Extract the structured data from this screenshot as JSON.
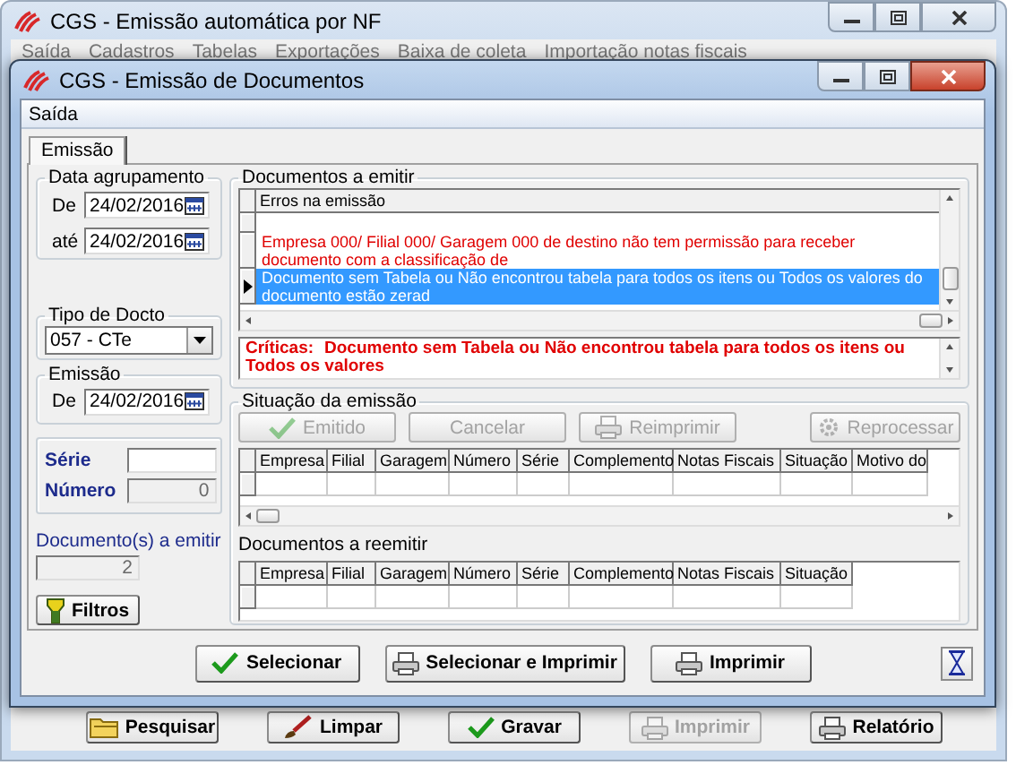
{
  "background_window": {
    "title": "CGS - Emissão automática por NF",
    "menu": [
      "Saída",
      "Cadastros",
      "Tabelas",
      "Exportações",
      "Baixa de coleta",
      "Importação notas fiscais"
    ],
    "buttons": [
      {
        "label": "Pesquisar",
        "kind": "search",
        "disabled": false
      },
      {
        "label": "Limpar",
        "kind": "clear",
        "disabled": false
      },
      {
        "label": "Gravar",
        "kind": "confirm",
        "disabled": false
      },
      {
        "label": "Imprimir",
        "kind": "print",
        "disabled": true
      },
      {
        "label": "Relatório",
        "kind": "print",
        "disabled": false
      }
    ]
  },
  "window": {
    "title": "CGS - Emissão de Documentos",
    "menu": [
      "Saída"
    ],
    "tabs": [
      {
        "label": "Emissão",
        "selected": true
      }
    ],
    "data_agrupamento": {
      "title": "Data agrupamento",
      "fields": [
        {
          "label": "De",
          "value": "24/02/2016"
        },
        {
          "label": "até",
          "value": "24/02/2016"
        }
      ]
    },
    "tipo_docto": {
      "title": "Tipo de Docto",
      "value": "057 - CTe"
    },
    "emissao": {
      "title": "Emissão",
      "fields": [
        {
          "label": "De",
          "value": "24/02/2016"
        }
      ]
    },
    "serie": {
      "label": "Série"
    },
    "numero": {
      "label": "Número",
      "value": "0"
    },
    "documentos_a_emitir": {
      "label": "Documento(s) a emitir",
      "value": "2"
    },
    "filtros_button": {
      "label": "Filtros",
      "kind": "filter"
    },
    "documentos": {
      "title": "Documentos a emitir",
      "column": "Erros na emissão",
      "rows": [
        {
          "selected": false
        },
        {
          "text": "Empresa 000/ Filial 000/ Garagem 000 de destino não tem permissão para receber documento com a classificação de",
          "selected": false
        },
        {
          "text": "Documento sem Tabela ou Não encontrou tabela para todos os itens ou Todos os valores do documento estão zerad",
          "selected": true
        }
      ]
    },
    "criticas": {
      "label": "Críticas:",
      "text": "Documento sem Tabela ou Não encontrou tabela para todos os itens ou Todos os valores"
    },
    "situacao": {
      "title": "Situação da emissão",
      "buttons": [
        {
          "label": "Emitido",
          "kind": "confirm",
          "disabled": true
        },
        {
          "label": "Cancelar",
          "kind": "plain",
          "disabled": true
        },
        {
          "label": "Reimprimir",
          "kind": "print",
          "disabled": true
        },
        {
          "label": "Reprocessar",
          "kind": "reprocess",
          "disabled": true
        }
      ],
      "columns": [
        "Empresa",
        "Filial",
        "Garagem",
        "Número",
        "Série",
        "Complemento",
        "Notas Fiscais",
        "Situação",
        "Motivo do"
      ]
    },
    "reemitir": {
      "title": "Documentos a reemitir",
      "columns": [
        "Empresa",
        "Filial",
        "Garagem",
        "Número",
        "Série",
        "Complemento",
        "Notas Fiscais",
        "Situação"
      ]
    },
    "buttons": [
      {
        "label": "Selecionar",
        "kind": "confirm"
      },
      {
        "label": "Selecionar e Imprimir",
        "kind": "print"
      },
      {
        "label": "Imprimir",
        "kind": "print"
      }
    ]
  }
}
